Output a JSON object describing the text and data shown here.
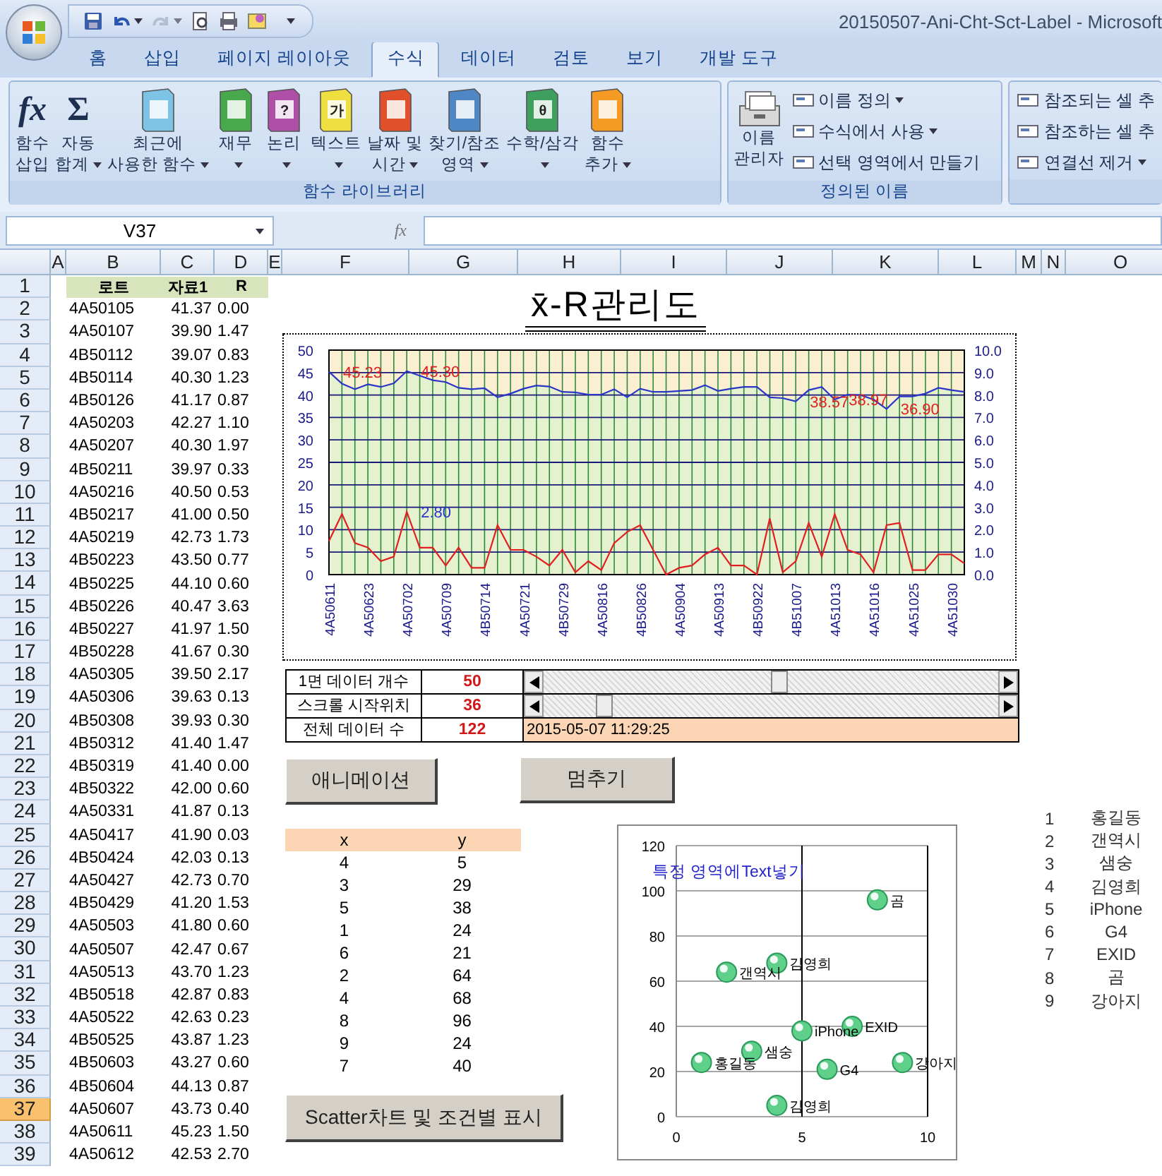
{
  "window": {
    "title": "20150507-Ani-Cht-Sct-Label - Microsoft"
  },
  "quick_access": [
    {
      "kind": "save",
      "disabled": false,
      "dropdown": false
    },
    {
      "kind": "undo",
      "disabled": false,
      "dropdown": true
    },
    {
      "kind": "redo",
      "disabled": true,
      "dropdown": true
    },
    {
      "kind": "preview",
      "disabled": false,
      "dropdown": false
    },
    {
      "kind": "print",
      "disabled": false,
      "dropdown": false
    },
    {
      "kind": "form",
      "disabled": false,
      "dropdown": false
    }
  ],
  "tabs": [
    {
      "label": "홈",
      "selected": false
    },
    {
      "label": "삽입",
      "selected": false
    },
    {
      "label": "페이지 레이아웃",
      "selected": false
    },
    {
      "label": "수식",
      "selected": true
    },
    {
      "label": "데이터",
      "selected": false
    },
    {
      "label": "검토",
      "selected": false
    },
    {
      "label": "보기",
      "selected": false
    },
    {
      "label": "개발 도구",
      "selected": false
    }
  ],
  "ribbon": [
    {
      "label": "함수 라이브러리",
      "items": [
        {
          "kind": "italic-glyph",
          "glyph": "fx",
          "lines": [
            "함수",
            "삽입"
          ],
          "dropdown": false
        },
        {
          "kind": "glyph",
          "glyph": "Σ",
          "lines": [
            "자동",
            "합계"
          ],
          "dropdown": true
        },
        {
          "kind": "book",
          "color": "#7cc3e6",
          "lines": [
            "최근에",
            "사용한 함수"
          ],
          "dropdown": true
        },
        {
          "kind": "book",
          "color": "#48a84c",
          "lines": [
            "재무"
          ],
          "dropdown": true
        },
        {
          "kind": "book",
          "color": "#b04fa8",
          "glyph": "?",
          "lines": [
            "논리"
          ],
          "dropdown": true
        },
        {
          "kind": "book",
          "color": "#f0df40",
          "glyph": "가",
          "lines": [
            "텍스트"
          ],
          "dropdown": true
        },
        {
          "kind": "book",
          "color": "#e0502a",
          "lines": [
            "날짜 및",
            "시간"
          ],
          "dropdown": true
        },
        {
          "kind": "book",
          "color": "#4f86c6",
          "lines": [
            "찾기/참조",
            "영역"
          ],
          "dropdown": true
        },
        {
          "kind": "book",
          "color": "#3f9f5f",
          "glyph": "θ",
          "lines": [
            "수학/삼각"
          ],
          "dropdown": true
        },
        {
          "kind": "book",
          "color": "#f59a23",
          "lines": [
            "함수",
            "추가"
          ],
          "dropdown": true
        }
      ]
    },
    {
      "label": "정의된 이름",
      "items": [
        {
          "kind": "cabinet",
          "lines": [
            "이름",
            "관리자"
          ],
          "dropdown": false
        },
        {
          "kind": "small",
          "label": "이름 정의",
          "dropdown": true
        },
        {
          "kind": "small",
          "label": "수식에서 사용",
          "dropdown": true
        },
        {
          "kind": "small",
          "label": "선택 영역에서 만들기",
          "dropdown": false
        }
      ]
    },
    {
      "items": [
        {
          "kind": "small",
          "label": "참조되는 셀 추",
          "dropdown": false
        },
        {
          "kind": "small",
          "label": "참조하는 셀 추",
          "dropdown": false
        },
        {
          "kind": "small",
          "label": "연결선 제거",
          "dropdown": true
        }
      ]
    }
  ],
  "formula_bar": {
    "name_box": "V37",
    "fx": "fx"
  },
  "sheet": {
    "columns": [
      "A",
      "B",
      "C",
      "D",
      "E",
      "F",
      "G",
      "H",
      "I",
      "J",
      "K",
      "L",
      "M",
      "N",
      "O"
    ],
    "rows": [
      {
        "number": "1",
        "selected": false,
        "kind": "header",
        "cells": [
          "",
          "로트",
          "자료1",
          "R"
        ]
      },
      {
        "number": "2",
        "selected": false,
        "kind": "data",
        "cells": [
          "",
          "4A50105",
          "41.37",
          "0.00"
        ]
      },
      {
        "number": "3",
        "selected": false,
        "kind": "data",
        "cells": [
          "",
          "4A50107",
          "39.90",
          "1.47"
        ]
      },
      {
        "number": "4",
        "selected": false,
        "kind": "data",
        "cells": [
          "",
          "4B50112",
          "39.07",
          "0.83"
        ]
      },
      {
        "number": "5",
        "selected": false,
        "kind": "data",
        "cells": [
          "",
          "4B50114",
          "40.30",
          "1.23"
        ]
      },
      {
        "number": "6",
        "selected": false,
        "kind": "data",
        "cells": [
          "",
          "4B50126",
          "41.17",
          "0.87"
        ]
      },
      {
        "number": "7",
        "selected": false,
        "kind": "data",
        "cells": [
          "",
          "4A50203",
          "42.27",
          "1.10"
        ]
      },
      {
        "number": "8",
        "selected": false,
        "kind": "data",
        "cells": [
          "",
          "4A50207",
          "40.30",
          "1.97"
        ]
      },
      {
        "number": "9",
        "selected": false,
        "kind": "data",
        "cells": [
          "",
          "4B50211",
          "39.97",
          "0.33"
        ]
      },
      {
        "number": "10",
        "selected": false,
        "kind": "data",
        "cells": [
          "",
          "4A50216",
          "40.50",
          "0.53"
        ]
      },
      {
        "number": "11",
        "selected": false,
        "kind": "data",
        "cells": [
          "",
          "4B50217",
          "41.00",
          "0.50"
        ]
      },
      {
        "number": "12",
        "selected": false,
        "kind": "data",
        "cells": [
          "",
          "4A50219",
          "42.73",
          "1.73"
        ]
      },
      {
        "number": "13",
        "selected": false,
        "kind": "data",
        "cells": [
          "",
          "4B50223",
          "43.50",
          "0.77"
        ]
      },
      {
        "number": "14",
        "selected": false,
        "kind": "data",
        "cells": [
          "",
          "4B50225",
          "44.10",
          "0.60"
        ]
      },
      {
        "number": "15",
        "selected": false,
        "kind": "data",
        "cells": [
          "",
          "4B50226",
          "40.47",
          "3.63"
        ]
      },
      {
        "number": "16",
        "selected": false,
        "kind": "data",
        "cells": [
          "",
          "4B50227",
          "41.97",
          "1.50"
        ]
      },
      {
        "number": "17",
        "selected": false,
        "kind": "data",
        "cells": [
          "",
          "4B50228",
          "41.67",
          "0.30"
        ]
      },
      {
        "number": "18",
        "selected": false,
        "kind": "data",
        "cells": [
          "",
          "4A50305",
          "39.50",
          "2.17"
        ]
      },
      {
        "number": "19",
        "selected": false,
        "kind": "data",
        "cells": [
          "",
          "4A50306",
          "39.63",
          "0.13"
        ]
      },
      {
        "number": "20",
        "selected": false,
        "kind": "data",
        "cells": [
          "",
          "4B50308",
          "39.93",
          "0.30"
        ]
      },
      {
        "number": "21",
        "selected": false,
        "kind": "data",
        "cells": [
          "",
          "4B50312",
          "41.40",
          "1.47"
        ]
      },
      {
        "number": "22",
        "selected": false,
        "kind": "data",
        "cells": [
          "",
          "4B50319",
          "41.40",
          "0.00"
        ]
      },
      {
        "number": "23",
        "selected": false,
        "kind": "data",
        "cells": [
          "",
          "4B50322",
          "42.00",
          "0.60"
        ]
      },
      {
        "number": "24",
        "selected": false,
        "kind": "data",
        "cells": [
          "",
          "4A50331",
          "41.87",
          "0.13"
        ]
      },
      {
        "number": "25",
        "selected": false,
        "kind": "data",
        "cells": [
          "",
          "4A50417",
          "41.90",
          "0.03"
        ]
      },
      {
        "number": "26",
        "selected": false,
        "kind": "data",
        "cells": [
          "",
          "4B50424",
          "42.03",
          "0.13"
        ]
      },
      {
        "number": "27",
        "selected": false,
        "kind": "data",
        "cells": [
          "",
          "4A50427",
          "42.73",
          "0.70"
        ]
      },
      {
        "number": "28",
        "selected": false,
        "kind": "data",
        "cells": [
          "",
          "4B50429",
          "41.20",
          "1.53"
        ]
      },
      {
        "number": "29",
        "selected": false,
        "kind": "data",
        "cells": [
          "",
          "4A50503",
          "41.80",
          "0.60"
        ]
      },
      {
        "number": "30",
        "selected": false,
        "kind": "data",
        "cells": [
          "",
          "4A50507",
          "42.47",
          "0.67"
        ]
      },
      {
        "number": "31",
        "selected": false,
        "kind": "data",
        "cells": [
          "",
          "4A50513",
          "43.70",
          "1.23"
        ]
      },
      {
        "number": "32",
        "selected": false,
        "kind": "data",
        "cells": [
          "",
          "4B50518",
          "42.87",
          "0.83"
        ]
      },
      {
        "number": "33",
        "selected": false,
        "kind": "data",
        "cells": [
          "",
          "4A50522",
          "42.63",
          "0.23"
        ]
      },
      {
        "number": "34",
        "selected": false,
        "kind": "data",
        "cells": [
          "",
          "4B50525",
          "43.87",
          "1.23"
        ]
      },
      {
        "number": "35",
        "selected": false,
        "kind": "data",
        "cells": [
          "",
          "4B50603",
          "43.27",
          "0.60"
        ]
      },
      {
        "number": "36",
        "selected": false,
        "kind": "data",
        "cells": [
          "",
          "4B50604",
          "44.13",
          "0.87"
        ]
      },
      {
        "number": "37",
        "selected": true,
        "kind": "data",
        "cells": [
          "",
          "4A50607",
          "43.73",
          "0.40"
        ]
      },
      {
        "number": "38",
        "selected": false,
        "kind": "data",
        "cells": [
          "",
          "4A50611",
          "45.23",
          "1.50"
        ]
      },
      {
        "number": "39",
        "selected": false,
        "kind": "data",
        "cells": [
          "",
          "4A50612",
          "42.53",
          "2.70"
        ]
      }
    ]
  },
  "chart_heading": "x̄-R관리도",
  "xr_chart": {
    "chart_data": {
      "type": "line",
      "ylim": [
        0,
        50
      ],
      "yticks": [
        0,
        5,
        10,
        15,
        20,
        25,
        30,
        35,
        40,
        45,
        50
      ],
      "y2lim": [
        0,
        10
      ],
      "y2ticks": [
        {
          "value": 0,
          "label": "0.0"
        },
        {
          "value": 1,
          "label": "1.0"
        },
        {
          "value": 2,
          "label": "2.0"
        },
        {
          "value": 3,
          "label": "3.0"
        },
        {
          "value": 4,
          "label": "4.0"
        },
        {
          "value": 5,
          "label": "5.0"
        },
        {
          "value": 6,
          "label": "6.0"
        },
        {
          "value": 7,
          "label": "7.0"
        },
        {
          "value": 8,
          "label": "8.0"
        },
        {
          "value": 9,
          "label": "9.0"
        },
        {
          "value": 10,
          "label": "10.0"
        }
      ],
      "categories": [
        "4A50611",
        null,
        null,
        "4A50623",
        null,
        null,
        "4A50702",
        null,
        null,
        "4A50709",
        null,
        null,
        "4B50714",
        null,
        null,
        "4A50721",
        null,
        null,
        "4B50729",
        null,
        null,
        "4A50816",
        null,
        null,
        "4B50826",
        null,
        null,
        "4A50904",
        null,
        null,
        "4A50913",
        null,
        null,
        "4B50922",
        null,
        null,
        "4B51007",
        null,
        null,
        "4A51013",
        null,
        null,
        "4A51016",
        null,
        null,
        "4A51025",
        null,
        null,
        "4A51030",
        null
      ],
      "series": [
        {
          "color": "#2b35c8",
          "values": [
            45.2,
            42.5,
            41.3,
            42.4,
            41.8,
            42.6,
            45.3,
            44.3,
            43.3,
            42.9,
            41.6,
            41.3,
            41.5,
            39.5,
            40.3,
            41.4,
            42.1,
            41.9,
            40.7,
            40.6,
            40.1,
            40.1,
            41.3,
            39.5,
            41.4,
            40.7,
            40.7,
            40.9,
            41.1,
            42.2,
            40.9,
            41.4,
            41.8,
            41.8,
            39.5,
            39.3,
            38.6,
            41.1,
            41.8,
            39.0,
            40.1,
            40.0,
            39.0,
            36.9,
            39.7,
            39.7,
            40.3,
            41.6,
            41.1,
            40.7
          ]
        },
        {
          "color": "#e02020",
          "axis": "y2",
          "values": [
            1.5,
            2.7,
            1.4,
            1.2,
            0.6,
            0.8,
            2.8,
            1.2,
            1.2,
            0.4,
            1.2,
            0.3,
            0.3,
            2.2,
            1.1,
            1.1,
            0.8,
            0.4,
            1.1,
            0.1,
            0.6,
            0.2,
            1.4,
            1.9,
            2.2,
            1.1,
            0.0,
            0.3,
            0.4,
            0.9,
            1.2,
            0.4,
            0.4,
            0.0,
            2.5,
            0.1,
            0.6,
            2.3,
            0.8,
            2.7,
            1.1,
            0.9,
            0.1,
            2.2,
            2.3,
            0.2,
            0.2,
            0.9,
            0.9,
            0.5
          ]
        }
      ],
      "grid": true,
      "annotations": [
        "45.23",
        "45.30",
        "38.57",
        "38.97",
        "36.90",
        "2.80"
      ]
    }
  },
  "controls": [
    {
      "label": "1면 데이터 개수",
      "value": "50",
      "kind": "scrollbar"
    },
    {
      "label": "스크롤 시작위치",
      "value": "36",
      "kind": "scrollbar"
    },
    {
      "label": "전체 데이터 수",
      "value": "122",
      "kind": "timestamp",
      "text": "2015-05-07 11:29:25"
    }
  ],
  "buttons": [
    {
      "label": "애니메이션"
    },
    {
      "label": "멈추기"
    },
    {
      "label": "Scatter차트 및 조건별 표시"
    }
  ],
  "xy_table": {
    "columns": [
      "x",
      "y"
    ],
    "rows": [
      [
        "4",
        "5"
      ],
      [
        "3",
        "29"
      ],
      [
        "5",
        "38"
      ],
      [
        "1",
        "24"
      ],
      [
        "6",
        "21"
      ],
      [
        "2",
        "64"
      ],
      [
        "4",
        "68"
      ],
      [
        "8",
        "96"
      ],
      [
        "9",
        "24"
      ],
      [
        "7",
        "40"
      ]
    ]
  },
  "scatter": {
    "chart_data": {
      "type": "scatter",
      "title": "특정 영역에Text넣기",
      "xlim": [
        0,
        10
      ],
      "ylim": [
        0,
        120
      ],
      "xticks": [
        0,
        5,
        10
      ],
      "yticks": [
        0,
        20,
        40,
        60,
        80,
        100,
        120
      ],
      "grid": true,
      "ref_lines": [
        {
          "axis": "x",
          "value": 5
        },
        {
          "axis": "x",
          "value": 10
        }
      ],
      "x": [
        4,
        3,
        5,
        1,
        6,
        2,
        4,
        8,
        9,
        7
      ],
      "series": [
        {
          "color": "#5fd08a",
          "values": [
            5,
            29,
            38,
            24,
            21,
            64,
            68,
            96,
            24,
            40
          ]
        }
      ],
      "annotations": [
        "김영희",
        "샘숭",
        "iPhone",
        "홍길동",
        "G4",
        "갠역시",
        "김영희",
        "곰",
        "강아지",
        "EXID"
      ]
    }
  },
  "name_list": [
    {
      "number": "1",
      "name": "홍길동"
    },
    {
      "number": "2",
      "name": "갠역시"
    },
    {
      "number": "3",
      "name": "샘숭"
    },
    {
      "number": "4",
      "name": "김영희"
    },
    {
      "number": "5",
      "name": "iPhone"
    },
    {
      "number": "6",
      "name": "G4"
    },
    {
      "number": "7",
      "name": "EXID"
    },
    {
      "number": "8",
      "name": "곰"
    },
    {
      "number": "9",
      "name": "강아지"
    }
  ]
}
